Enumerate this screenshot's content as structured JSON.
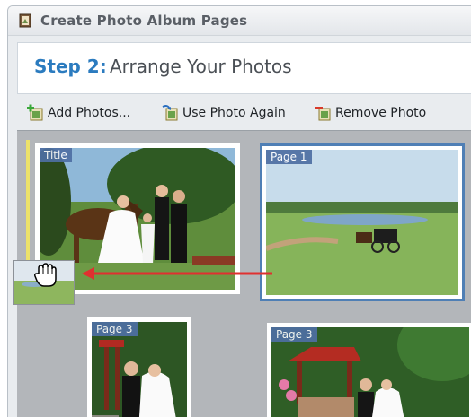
{
  "window": {
    "title": "Create Photo Album Pages"
  },
  "header": {
    "step_label": "Step 2:",
    "step_title": "Arrange Your Photos"
  },
  "toolbar": {
    "add_photos": "Add Photos...",
    "use_photo_again": "Use Photo Again",
    "remove_photo": "Remove Photo"
  },
  "slots": {
    "title": "Title",
    "page1": "Page 1",
    "page3a": "Page 3",
    "page3b": "Page 3"
  },
  "colors": {
    "accent": "#2b7bbf",
    "selection": "#4f7fb5",
    "arrow": "#e03030",
    "tag_bg": "#4e6fa3"
  },
  "icons": [
    "album-icon",
    "add-photo-icon",
    "use-again-icon",
    "remove-photo-icon",
    "hand-cursor-icon"
  ]
}
